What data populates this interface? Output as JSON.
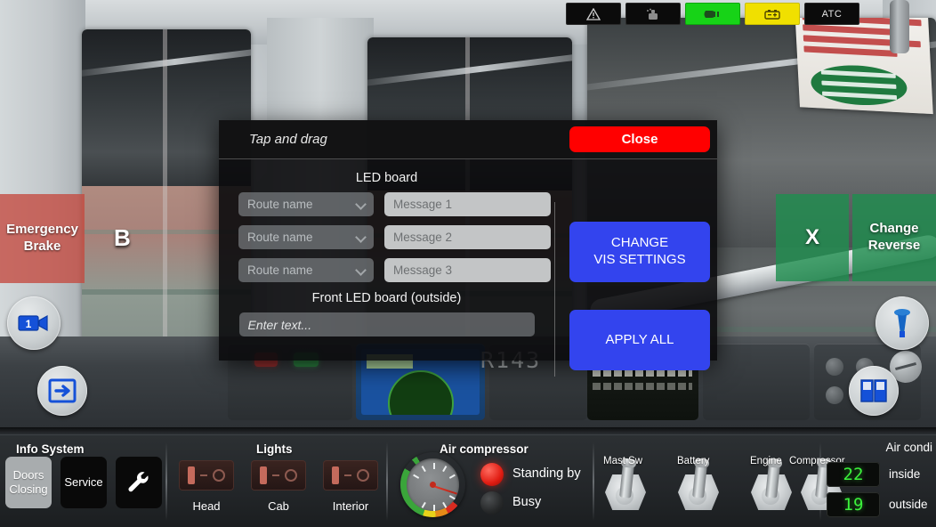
{
  "scene": {
    "train_id": "R143"
  },
  "status_bar": {
    "chips": [
      {
        "name": "warning-icon",
        "label": "",
        "state": "dark"
      },
      {
        "name": "compressor-icon",
        "label": "",
        "state": "dark"
      },
      {
        "name": "headlight-icon",
        "label": "",
        "state": "green"
      },
      {
        "name": "battery-icon",
        "label": "",
        "state": "yellow"
      },
      {
        "name": "atc-indicator",
        "label": "ATC",
        "state": "dark"
      }
    ]
  },
  "hud": {
    "emergency_brake": "Emergency\nBrake",
    "emergency_brake_line1": "Emergency",
    "emergency_brake_line2": "Brake",
    "brake_letter": "B",
    "x_button": "X",
    "change_reverse_line1": "Change",
    "change_reverse_line2": "Reverse",
    "camera_number": "1"
  },
  "dialog": {
    "drag_hint": "Tap and drag",
    "close_label": "Close",
    "led_board_title": "LED board",
    "front_led_title": "Front LED board (outside)",
    "rows": [
      {
        "route_placeholder": "Route name",
        "message_placeholder": "Message 1"
      },
      {
        "route_placeholder": "Route name",
        "message_placeholder": "Message 2"
      },
      {
        "route_placeholder": "Route name",
        "message_placeholder": "Message 3"
      }
    ],
    "front_led_placeholder": "Enter text...",
    "change_vis_line1": "CHANGE",
    "change_vis_line2": "VIS SETTINGS",
    "apply_all_label": "APPLY ALL",
    "accent_blue": "#3344ee",
    "accent_red": "#ff0000"
  },
  "bottom_bar": {
    "info_system": {
      "title": "Info System",
      "buttons": [
        {
          "label": "Doors\nClosing",
          "line1": "Doors",
          "line2": "Closing",
          "active": true
        },
        {
          "label": "Service",
          "line1": "Service",
          "line2": "",
          "active": false
        },
        {
          "label": "",
          "line1": "",
          "line2": "",
          "active": false,
          "icon": "wrench-icon"
        }
      ]
    },
    "lights": {
      "title": "Lights",
      "switches": [
        {
          "label": "Head"
        },
        {
          "label": "Cab"
        },
        {
          "label": "Interior"
        }
      ]
    },
    "air_compressor": {
      "title": "Air compressor",
      "lamps": [
        {
          "label": "Standing by",
          "on": true
        },
        {
          "label": "Busy",
          "on": false
        }
      ]
    },
    "toggles": [
      {
        "label": "Mast Sw"
      },
      {
        "label": "Battery"
      },
      {
        "label": "Engine"
      },
      {
        "label": "Compressor"
      }
    ],
    "air_conditioning": {
      "title": "Air condi",
      "readouts": [
        {
          "value": "22",
          "label": "inside"
        },
        {
          "value": "19",
          "label": "outside"
        }
      ]
    }
  }
}
